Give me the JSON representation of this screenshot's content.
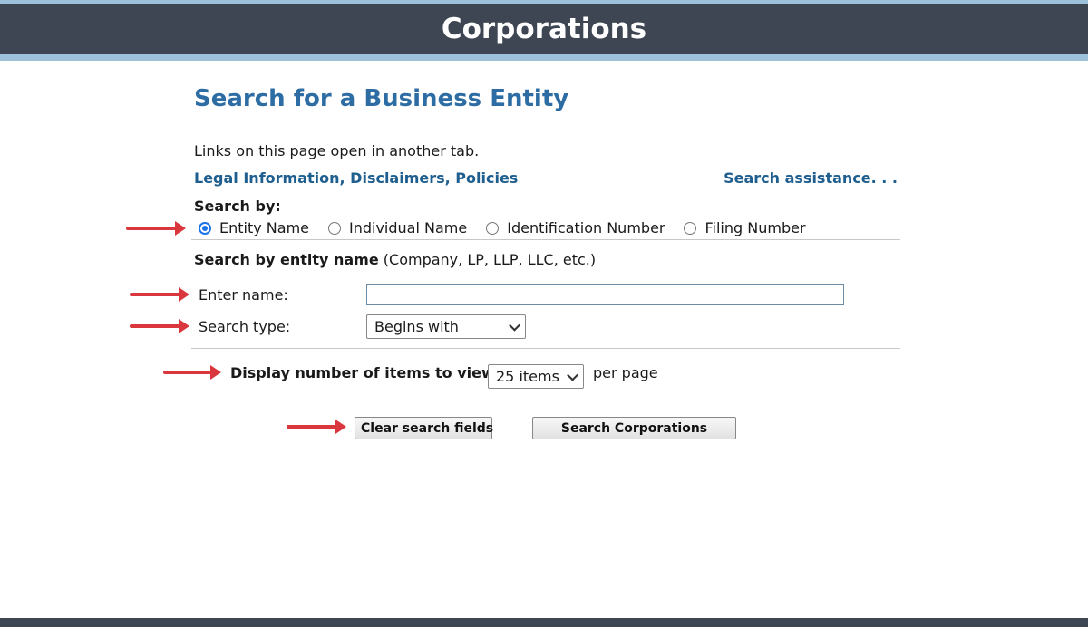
{
  "header": {
    "title": "Corporations"
  },
  "main": {
    "title": "Search for a Business Entity",
    "info_text": "Links on this page open in another tab.",
    "legal_link": "Legal Information, Disclaimers, Policies",
    "assistance_link": "Search assistance. . ."
  },
  "search_by": {
    "label": "Search by:",
    "options": [
      {
        "label": "Entity Name",
        "checked": true
      },
      {
        "label": "Individual Name",
        "checked": false
      },
      {
        "label": "Identification Number",
        "checked": false
      },
      {
        "label": "Filing Number",
        "checked": false
      }
    ]
  },
  "entity_section": {
    "heading_bold": "Search by entity name",
    "heading_rest": " (Company, LP, LLP, LLC, etc.)"
  },
  "form": {
    "name_label": "Enter name:",
    "name_value": "",
    "search_type_label": "Search type:",
    "search_type_value": "Begins with",
    "display_label": "Display number of items to view:",
    "items_value": "25 items",
    "per_page": "per page"
  },
  "buttons": {
    "clear": "Clear search fields",
    "search": "Search Corporations"
  },
  "colors": {
    "header_bar": "#3e4553",
    "header_accent": "#9cc1d9",
    "title_blue": "#2e6da4",
    "link_blue": "#1f5f8f",
    "arrow_red": "#d9363e",
    "radio_selected": "#1a73e8"
  }
}
